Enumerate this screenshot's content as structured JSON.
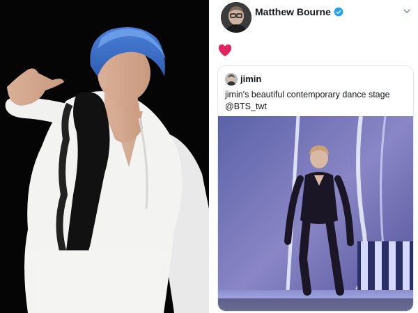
{
  "tweet": {
    "author_name": "Matthew Bourne",
    "verified": true,
    "reaction_emoji": "heart",
    "quoted": {
      "author_name": "jimin",
      "text_line1": "jimin's beautiful contemporary dance stage",
      "text_line2": "@BTS_twt"
    }
  },
  "colors": {
    "text": "#14171a",
    "verified": "#1da1f2",
    "heart": "#e0245e",
    "border": "#e1e8ed"
  }
}
